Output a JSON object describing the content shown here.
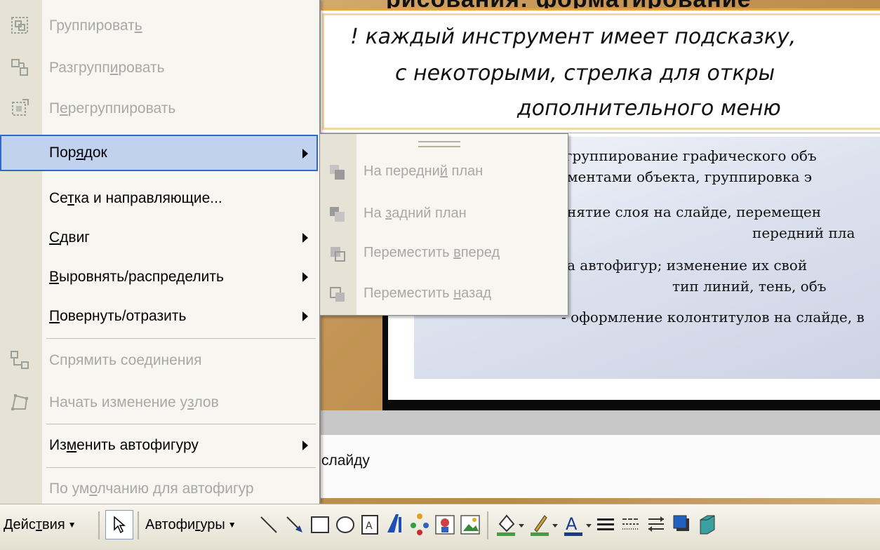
{
  "heading_partial": "рисования: форматирование",
  "note": {
    "line1": "! каждый инструмент имеет подсказку,",
    "line2": "с некоторыми, стрелка для откры",
    "line3": "дополнительного меню"
  },
  "slide_lines": [
    "группирование графического объ",
    "ментами объекта, группировка э",
    "нятие слоя на слайде, перемещен",
    "передний пла",
    "а автофигур; изменение их свой",
    "тип линий, тень, объ",
    "- оформление колонтитулов на слайде, в"
  ],
  "notes_text": "слайду",
  "menu": {
    "items": [
      {
        "pre": "Группироват",
        "acc": "ь",
        "post": "",
        "disabled": true,
        "icon": "group-icon"
      },
      {
        "pre": "Разгрупп",
        "acc": "и",
        "post": "ровать",
        "disabled": true,
        "icon": "ungroup-icon"
      },
      {
        "pre": "П",
        "acc": "е",
        "post": "регруппировать",
        "disabled": true,
        "icon": "regroup-icon"
      },
      {
        "pre": "Пор",
        "acc": "я",
        "post": "док",
        "disabled": false,
        "highlighted": true,
        "submenu": true
      },
      {
        "pre": "Се",
        "acc": "т",
        "post": "ка и направляющие...",
        "disabled": false
      },
      {
        "pre": "",
        "acc": "С",
        "post": "двиг",
        "disabled": false,
        "submenu": true
      },
      {
        "pre": "",
        "acc": "В",
        "post": "ыровнять/распределить",
        "disabled": false,
        "submenu": true
      },
      {
        "pre": "",
        "acc": "П",
        "post": "овернуть/отразить",
        "disabled": false,
        "submenu": true
      },
      {
        "pre": "Спрямить сое",
        "acc": "д",
        "post": "инения",
        "disabled": true,
        "icon": "reroute-connectors-icon"
      },
      {
        "pre": "Начать изменение у",
        "acc": "з",
        "post": "лов",
        "disabled": true,
        "icon": "edit-points-icon"
      },
      {
        "pre": "Из",
        "acc": "м",
        "post": "енить автофигуру",
        "disabled": false,
        "submenu": true
      },
      {
        "pre": "По ум",
        "acc": "о",
        "post": "лчанию для автофигур",
        "disabled": true
      }
    ]
  },
  "submenu": {
    "items": [
      {
        "pre": "На передни",
        "acc": "й",
        "post": " план",
        "icon": "bring-to-front-icon"
      },
      {
        "pre": "На ",
        "acc": "з",
        "post": "адний план",
        "icon": "send-to-back-icon"
      },
      {
        "pre": "Переместить ",
        "acc": "в",
        "post": "перед",
        "icon": "bring-forward-icon"
      },
      {
        "pre": "Переместить ",
        "acc": "н",
        "post": "азад",
        "icon": "send-backward-icon"
      }
    ]
  },
  "toolbar": {
    "actions_pre": "Дейс",
    "actions_acc": "т",
    "actions_post": "вия",
    "autoshapes_pre": "Автофи",
    "autoshapes_acc": "г",
    "autoshapes_post": "уры"
  }
}
